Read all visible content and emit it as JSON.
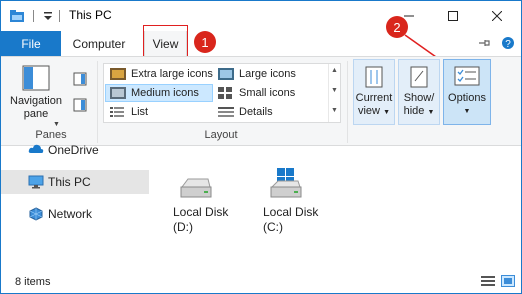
{
  "window": {
    "title": "This PC",
    "controls": {
      "minimize": "minimize-icon",
      "maximize": "maximize-icon",
      "close": "close-icon"
    }
  },
  "tabs": {
    "file": "File",
    "computer": "Computer",
    "view": "View"
  },
  "annotations": {
    "badge1": "1",
    "badge2": "2",
    "highlight_color": "#e02020"
  },
  "ribbon": {
    "panes": {
      "navigation_pane_line1": "Navigation",
      "navigation_pane_line2": "pane",
      "group_label": "Panes"
    },
    "layout": {
      "group_label": "Layout",
      "items": [
        "Extra large icons",
        "Large icons",
        "Medium icons",
        "Small icons",
        "List",
        "Details"
      ],
      "selected": "Medium icons"
    },
    "current_view": {
      "line1": "Current",
      "line2": "view"
    },
    "show_hide": {
      "line1": "Show/",
      "line2": "hide"
    },
    "options": {
      "label": "Options"
    }
  },
  "nav": {
    "items": [
      {
        "label": "OneDrive",
        "icon": "cloud-icon"
      },
      {
        "label": "This PC",
        "icon": "computer-icon",
        "selected": true
      },
      {
        "label": "Network",
        "icon": "network-icon"
      }
    ]
  },
  "content": {
    "drives": [
      {
        "name": "Local Disk",
        "letter": "(D:)",
        "icon": "hard-drive-icon"
      },
      {
        "name": "Local Disk",
        "letter": "(C:)",
        "icon": "windows-drive-icon"
      }
    ]
  },
  "status": {
    "items_count": "8 items"
  },
  "colors": {
    "accent": "#1979ca",
    "selected": "#cce8ff",
    "badge": "#d9261c"
  }
}
